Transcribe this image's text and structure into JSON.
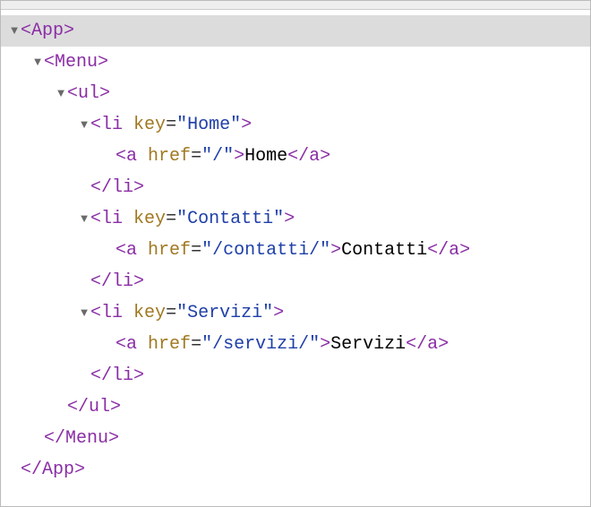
{
  "tree": {
    "app": {
      "open": "App",
      "close": "App"
    },
    "menu": {
      "open": "Menu",
      "close": "Menu"
    },
    "ul": {
      "open": "ul",
      "close": "ul"
    },
    "li": {
      "open": "li",
      "close": "li"
    },
    "a": {
      "open": "a",
      "close": "a"
    },
    "key_attr": "key",
    "href_attr": "href",
    "items": [
      {
        "key": "\"Home\"",
        "href": "\"/\"",
        "text": "Home"
      },
      {
        "key": "\"Contatti\"",
        "href": "\"/contatti/\"",
        "text": "Contatti"
      },
      {
        "key": "\"Servizi\"",
        "href": "\"/servizi/\"",
        "text": "Servizi"
      }
    ]
  }
}
